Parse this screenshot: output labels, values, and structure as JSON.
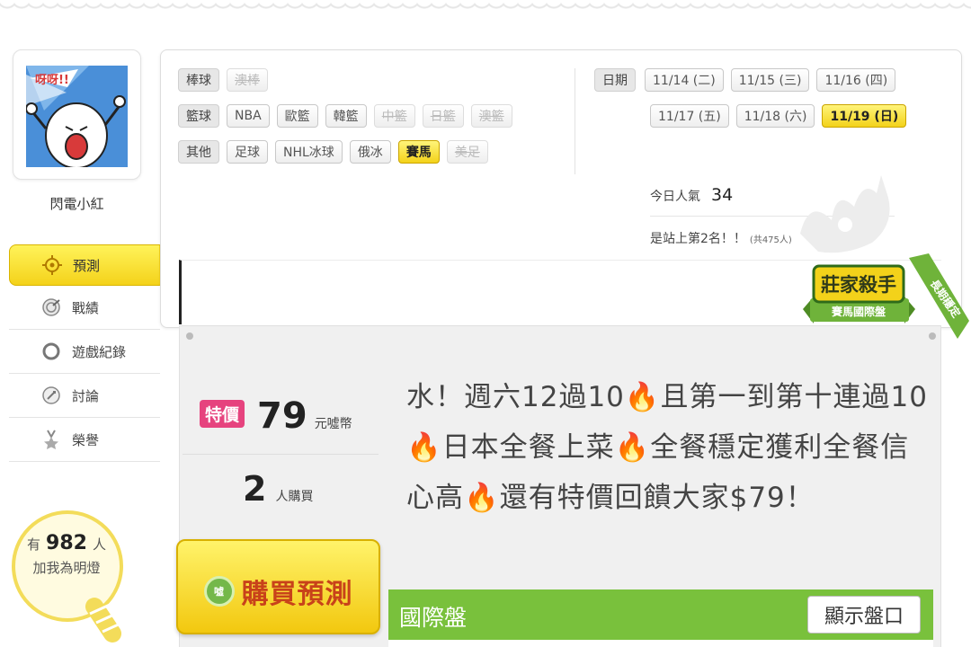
{
  "user": {
    "name": "閃電小紅",
    "avatar_shout": "呀呀!!"
  },
  "nav": [
    {
      "label": "預測",
      "icon": "target-icon",
      "active": true
    },
    {
      "label": "戰績",
      "icon": "record-icon"
    },
    {
      "label": "遊戲紀錄",
      "icon": "circle-icon"
    },
    {
      "label": "討論",
      "icon": "discuss-icon"
    },
    {
      "label": "榮譽",
      "icon": "medal-icon"
    }
  ],
  "fans": {
    "prefix": "有",
    "count": "982",
    "suffix": "人",
    "line2": "加我為明燈"
  },
  "filters": {
    "baseball": {
      "label": "棒球",
      "items": [
        {
          "text": "澳棒",
          "state": "disabled"
        }
      ]
    },
    "basketball": {
      "label": "籃球",
      "items": [
        {
          "text": "NBA",
          "state": "normal"
        },
        {
          "text": "歐籃",
          "state": "normal"
        },
        {
          "text": "韓籃",
          "state": "normal"
        },
        {
          "text": "中籃",
          "state": "disabled"
        },
        {
          "text": "日籃",
          "state": "disabled"
        },
        {
          "text": "澳籃",
          "state": "disabled"
        }
      ]
    },
    "other": {
      "label": "其他",
      "items": [
        {
          "text": "足球",
          "state": "normal"
        },
        {
          "text": "NHL冰球",
          "state": "normal"
        },
        {
          "text": "俄冰",
          "state": "normal"
        },
        {
          "text": "賽馬",
          "state": "selected"
        },
        {
          "text": "美足",
          "state": "disabled"
        }
      ]
    }
  },
  "dates": {
    "label": "日期",
    "row1": [
      "11/14 (二)",
      "11/15 (三)",
      "11/16 (四)"
    ],
    "row2": [
      "11/17 (五)",
      "11/18 (六)",
      "11/19 (日)"
    ],
    "selected": "11/19 (日)"
  },
  "stats": {
    "popularity_label": "今日人氣",
    "popularity_value": "34",
    "rank_text": "是站上第2名！！",
    "rank_total": "(共475人)"
  },
  "badge": {
    "title": "莊家殺手",
    "subtitle": "賽馬國際盤",
    "ribbon": "長期穩定"
  },
  "offer": {
    "tag": "特價",
    "price": "79",
    "unit": "元噓幣",
    "buyers_count": "2",
    "buyers_label": "人購買",
    "buy_button": "購買預測",
    "coin_label": "噓"
  },
  "description": "水！週六12過10🔥且第一到第十連過10🔥日本全餐上菜🔥全餐穩定獲利全餐信心高🔥還有特價回饋大家$79！",
  "market": {
    "title": "國際盤",
    "show_button": "顯示盤口"
  },
  "colors": {
    "accent_yellow": "#f4d21a",
    "price_pink": "#e6437e",
    "market_green": "#79c13c",
    "buy_text": "#c8421a"
  }
}
